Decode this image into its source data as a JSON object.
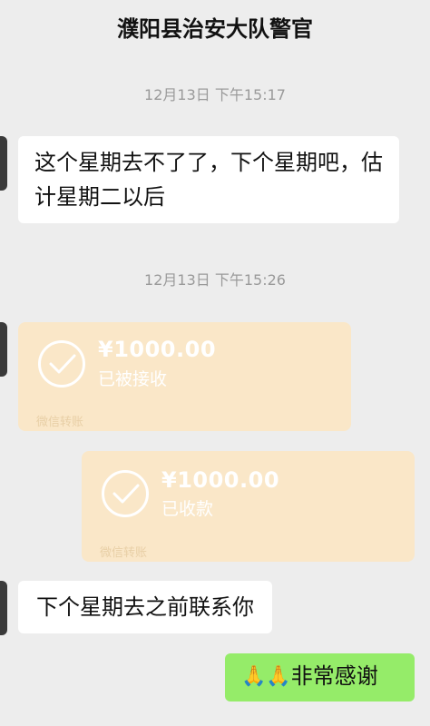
{
  "header": {
    "title": "濮阳县治安大队警官"
  },
  "timestamps": [
    "12月13日 下午15:17",
    "12月13日 下午15:26"
  ],
  "messages": {
    "msg1": "这个星期去不了了，下个星期吧，估计星期二以后",
    "msg2": "下个星期去之前联系你",
    "msg3_emoji": "🙏🙏",
    "msg3_text": "非常感谢"
  },
  "transfers": [
    {
      "amount": "¥1000.00",
      "status": "已被接收",
      "label": "微信转账"
    },
    {
      "amount": "¥1000.00",
      "status": "已收款",
      "label": "微信转账"
    }
  ],
  "colors": {
    "background": "#ededed",
    "bubble_incoming": "#ffffff",
    "bubble_outgoing": "#95ec69",
    "transfer_card": "#fae7c8"
  }
}
